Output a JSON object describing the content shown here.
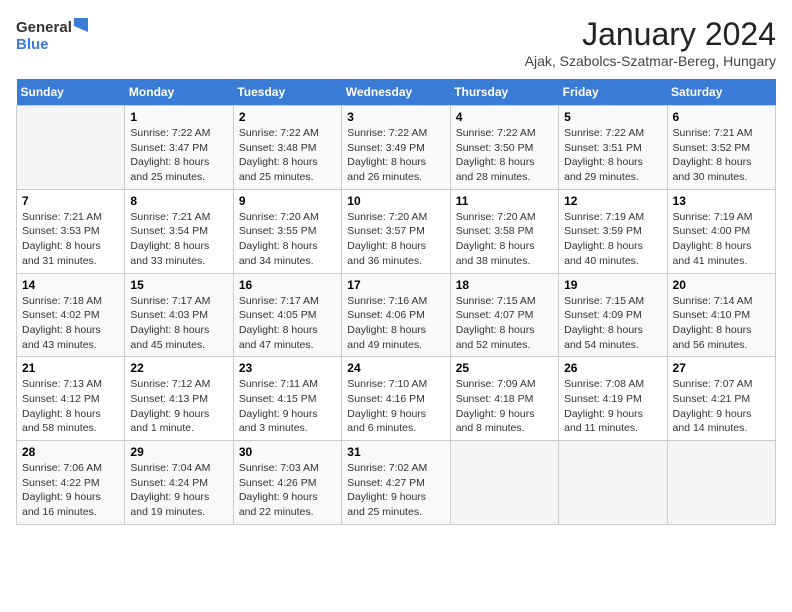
{
  "header": {
    "logo_line1": "General",
    "logo_line2": "Blue",
    "title": "January 2024",
    "subtitle": "Ajak, Szabolcs-Szatmar-Bereg, Hungary"
  },
  "days_of_week": [
    "Sunday",
    "Monday",
    "Tuesday",
    "Wednesday",
    "Thursday",
    "Friday",
    "Saturday"
  ],
  "weeks": [
    [
      {
        "num": "",
        "info": ""
      },
      {
        "num": "1",
        "info": "Sunrise: 7:22 AM\nSunset: 3:47 PM\nDaylight: 8 hours\nand 25 minutes."
      },
      {
        "num": "2",
        "info": "Sunrise: 7:22 AM\nSunset: 3:48 PM\nDaylight: 8 hours\nand 25 minutes."
      },
      {
        "num": "3",
        "info": "Sunrise: 7:22 AM\nSunset: 3:49 PM\nDaylight: 8 hours\nand 26 minutes."
      },
      {
        "num": "4",
        "info": "Sunrise: 7:22 AM\nSunset: 3:50 PM\nDaylight: 8 hours\nand 28 minutes."
      },
      {
        "num": "5",
        "info": "Sunrise: 7:22 AM\nSunset: 3:51 PM\nDaylight: 8 hours\nand 29 minutes."
      },
      {
        "num": "6",
        "info": "Sunrise: 7:21 AM\nSunset: 3:52 PM\nDaylight: 8 hours\nand 30 minutes."
      }
    ],
    [
      {
        "num": "7",
        "info": "Sunrise: 7:21 AM\nSunset: 3:53 PM\nDaylight: 8 hours\nand 31 minutes."
      },
      {
        "num": "8",
        "info": "Sunrise: 7:21 AM\nSunset: 3:54 PM\nDaylight: 8 hours\nand 33 minutes."
      },
      {
        "num": "9",
        "info": "Sunrise: 7:20 AM\nSunset: 3:55 PM\nDaylight: 8 hours\nand 34 minutes."
      },
      {
        "num": "10",
        "info": "Sunrise: 7:20 AM\nSunset: 3:57 PM\nDaylight: 8 hours\nand 36 minutes."
      },
      {
        "num": "11",
        "info": "Sunrise: 7:20 AM\nSunset: 3:58 PM\nDaylight: 8 hours\nand 38 minutes."
      },
      {
        "num": "12",
        "info": "Sunrise: 7:19 AM\nSunset: 3:59 PM\nDaylight: 8 hours\nand 40 minutes."
      },
      {
        "num": "13",
        "info": "Sunrise: 7:19 AM\nSunset: 4:00 PM\nDaylight: 8 hours\nand 41 minutes."
      }
    ],
    [
      {
        "num": "14",
        "info": "Sunrise: 7:18 AM\nSunset: 4:02 PM\nDaylight: 8 hours\nand 43 minutes."
      },
      {
        "num": "15",
        "info": "Sunrise: 7:17 AM\nSunset: 4:03 PM\nDaylight: 8 hours\nand 45 minutes."
      },
      {
        "num": "16",
        "info": "Sunrise: 7:17 AM\nSunset: 4:05 PM\nDaylight: 8 hours\nand 47 minutes."
      },
      {
        "num": "17",
        "info": "Sunrise: 7:16 AM\nSunset: 4:06 PM\nDaylight: 8 hours\nand 49 minutes."
      },
      {
        "num": "18",
        "info": "Sunrise: 7:15 AM\nSunset: 4:07 PM\nDaylight: 8 hours\nand 52 minutes."
      },
      {
        "num": "19",
        "info": "Sunrise: 7:15 AM\nSunset: 4:09 PM\nDaylight: 8 hours\nand 54 minutes."
      },
      {
        "num": "20",
        "info": "Sunrise: 7:14 AM\nSunset: 4:10 PM\nDaylight: 8 hours\nand 56 minutes."
      }
    ],
    [
      {
        "num": "21",
        "info": "Sunrise: 7:13 AM\nSunset: 4:12 PM\nDaylight: 8 hours\nand 58 minutes."
      },
      {
        "num": "22",
        "info": "Sunrise: 7:12 AM\nSunset: 4:13 PM\nDaylight: 9 hours\nand 1 minute."
      },
      {
        "num": "23",
        "info": "Sunrise: 7:11 AM\nSunset: 4:15 PM\nDaylight: 9 hours\nand 3 minutes."
      },
      {
        "num": "24",
        "info": "Sunrise: 7:10 AM\nSunset: 4:16 PM\nDaylight: 9 hours\nand 6 minutes."
      },
      {
        "num": "25",
        "info": "Sunrise: 7:09 AM\nSunset: 4:18 PM\nDaylight: 9 hours\nand 8 minutes."
      },
      {
        "num": "26",
        "info": "Sunrise: 7:08 AM\nSunset: 4:19 PM\nDaylight: 9 hours\nand 11 minutes."
      },
      {
        "num": "27",
        "info": "Sunrise: 7:07 AM\nSunset: 4:21 PM\nDaylight: 9 hours\nand 14 minutes."
      }
    ],
    [
      {
        "num": "28",
        "info": "Sunrise: 7:06 AM\nSunset: 4:22 PM\nDaylight: 9 hours\nand 16 minutes."
      },
      {
        "num": "29",
        "info": "Sunrise: 7:04 AM\nSunset: 4:24 PM\nDaylight: 9 hours\nand 19 minutes."
      },
      {
        "num": "30",
        "info": "Sunrise: 7:03 AM\nSunset: 4:26 PM\nDaylight: 9 hours\nand 22 minutes."
      },
      {
        "num": "31",
        "info": "Sunrise: 7:02 AM\nSunset: 4:27 PM\nDaylight: 9 hours\nand 25 minutes."
      },
      {
        "num": "",
        "info": ""
      },
      {
        "num": "",
        "info": ""
      },
      {
        "num": "",
        "info": ""
      }
    ]
  ]
}
